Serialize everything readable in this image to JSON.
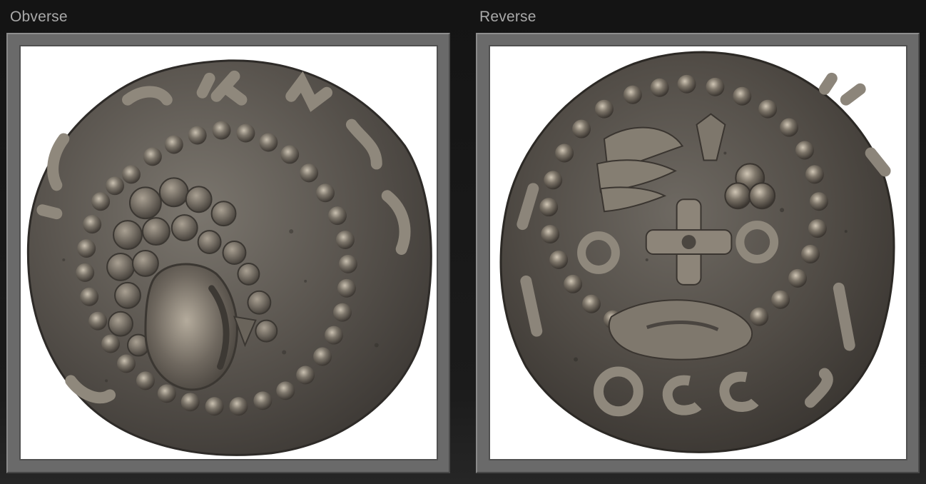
{
  "panels": [
    {
      "label": "Obverse",
      "image": "coin-obverse-bust-image"
    },
    {
      "label": "Reverse",
      "image": "coin-reverse-cross-image"
    }
  ],
  "colors": {
    "background": "#1a1a1a",
    "frame": "#6a6a6a",
    "label": "#a9a9a9",
    "coin_metal": "#5b5650",
    "coin_highlight": "#a9a092"
  }
}
